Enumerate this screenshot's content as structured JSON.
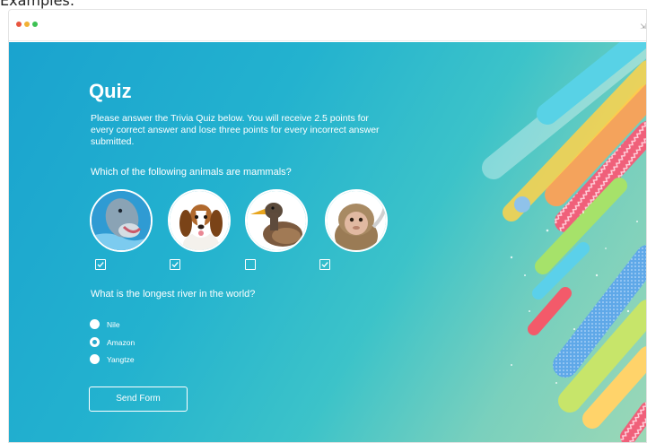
{
  "caption": "Examples:",
  "quiz": {
    "title": "Quiz",
    "intro": "Please answer the Trivia Quiz below. You will receive 2.5 points for every correct answer and lose three points for every incorrect answer submitted.",
    "question1": {
      "text": "Which of the following animals are mammals?",
      "options": [
        {
          "animal": "dolphin",
          "checked": true
        },
        {
          "animal": "beagle",
          "checked": true
        },
        {
          "animal": "duck",
          "checked": false
        },
        {
          "animal": "monkey",
          "checked": true
        }
      ]
    },
    "question2": {
      "text": "What is the longest river in the world?",
      "options": [
        {
          "label": "Nile",
          "selected": false
        },
        {
          "label": "Amazon",
          "selected": true
        },
        {
          "label": "Yangtze",
          "selected": false
        }
      ]
    },
    "submit_label": "Send Form"
  },
  "colors": {
    "gradient_start": "#1aa3cf",
    "gradient_end": "#9cd8b6",
    "text": "#ffffff"
  }
}
